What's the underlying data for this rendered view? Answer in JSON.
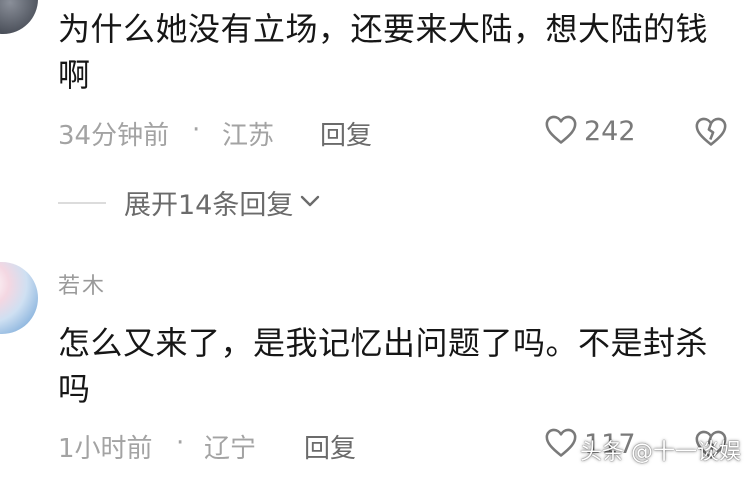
{
  "comments": [
    {
      "text": "为什么她没有立场，还要来大陆，想大陆的钱啊",
      "time": "34分钟前",
      "separator": "·",
      "location": "江苏",
      "reply_label": "回复",
      "like_count": "242",
      "expand_label": "展开14条回复"
    },
    {
      "username": "若木",
      "text": "怎么又来了，是我记忆出问题了吗。不是封杀吗",
      "time": "1小时前",
      "separator": "·",
      "location": "辽宁",
      "reply_label": "回复",
      "like_count": "117"
    }
  ],
  "watermark": "头条 @十一谈娱",
  "icons": [
    "heart-icon",
    "dislike-heart-icon",
    "chevron-down-icon"
  ],
  "colors": {
    "text": "#161616",
    "meta": "#a3a3a3",
    "secondary": "#6b6b6b",
    "background": "#ffffff"
  }
}
